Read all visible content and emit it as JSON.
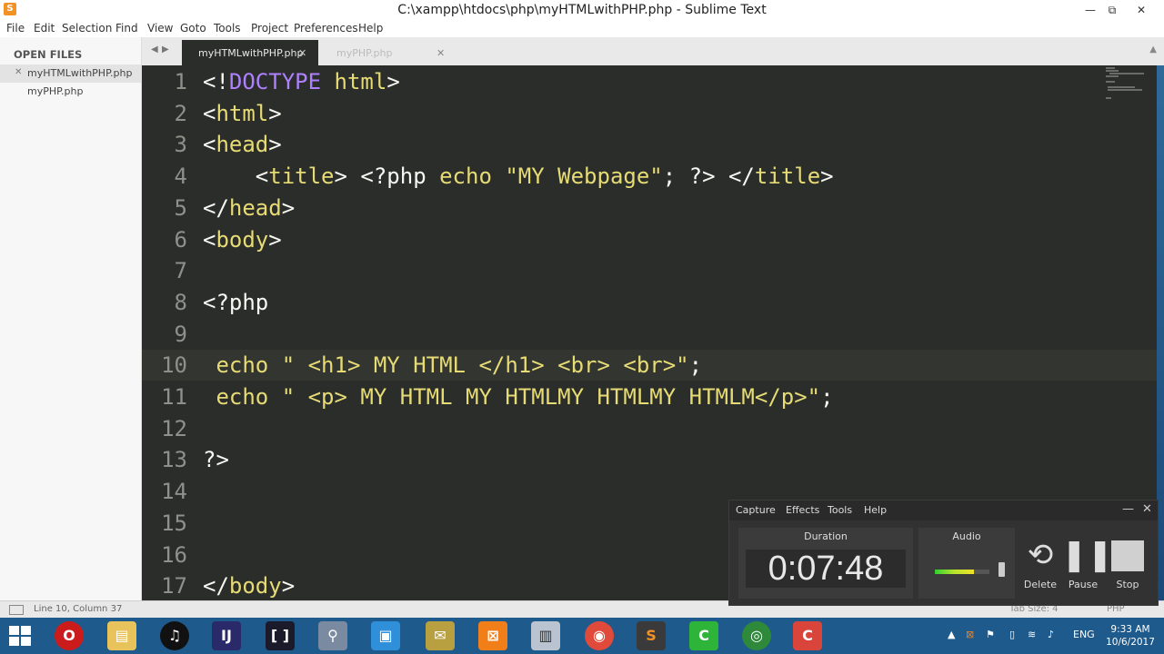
{
  "window": {
    "title": "C:\\xampp\\htdocs\\php\\myHTMLwithPHP.php - Sublime Text",
    "controls": [
      "—",
      "⧉",
      "✕"
    ]
  },
  "menubar": {
    "items": [
      "File",
      "Edit",
      "Selection",
      "Find",
      "View",
      "Goto",
      "Tools",
      "Project",
      "Preferences",
      "Help"
    ]
  },
  "sidebar": {
    "header": "OPEN FILES",
    "files": [
      {
        "name": "myHTMLwithPHP.php",
        "active": true
      },
      {
        "name": "myPHP.php",
        "active": false
      }
    ]
  },
  "tabs": [
    {
      "label": "myHTMLwithPHP.php",
      "active": true
    },
    {
      "label": "myPHP.php",
      "active": false
    }
  ],
  "editor": {
    "current_line": 10,
    "lines": [
      {
        "n": "1",
        "parts": [
          [
            "br",
            "<!"
          ],
          [
            "doc",
            "DOCTYPE"
          ],
          [
            "tag",
            " html"
          ],
          [
            "br",
            ">"
          ]
        ]
      },
      {
        "n": "2",
        "parts": [
          [
            "br",
            "<"
          ],
          [
            "tag",
            "html"
          ],
          [
            "br",
            ">"
          ]
        ]
      },
      {
        "n": "3",
        "parts": [
          [
            "br",
            "<"
          ],
          [
            "tag",
            "head"
          ],
          [
            "br",
            ">"
          ]
        ]
      },
      {
        "n": "4",
        "parts": [
          [
            "br",
            "    <"
          ],
          [
            "tag",
            "title"
          ],
          [
            "br",
            "> <?php "
          ],
          [
            "tag",
            "echo "
          ],
          [
            "tag",
            "\"MY Webpage\""
          ],
          [
            "br",
            "; ?> </"
          ],
          [
            "tag",
            "title"
          ],
          [
            "br",
            ">"
          ]
        ]
      },
      {
        "n": "5",
        "parts": [
          [
            "br",
            "</"
          ],
          [
            "tag",
            "head"
          ],
          [
            "br",
            ">"
          ]
        ]
      },
      {
        "n": "6",
        "parts": [
          [
            "br",
            "<"
          ],
          [
            "tag",
            "body"
          ],
          [
            "br",
            ">"
          ]
        ]
      },
      {
        "n": "7",
        "parts": []
      },
      {
        "n": "8",
        "parts": [
          [
            "br",
            "<?php"
          ]
        ]
      },
      {
        "n": "9",
        "parts": []
      },
      {
        "n": "10",
        "parts": [
          [
            "tag",
            " echo "
          ],
          [
            "tag",
            "\" <h1> MY HTML </h1> <br> <br>\""
          ],
          [
            "br",
            ";"
          ]
        ]
      },
      {
        "n": "11",
        "parts": [
          [
            "tag",
            " echo "
          ],
          [
            "tag",
            "\" <p> MY HTML MY HTMLMY HTMLMY HTMLM</p>\""
          ],
          [
            "br",
            ";"
          ]
        ]
      },
      {
        "n": "12",
        "parts": []
      },
      {
        "n": "13",
        "parts": [
          [
            "br",
            "?>"
          ]
        ]
      },
      {
        "n": "14",
        "parts": []
      },
      {
        "n": "15",
        "parts": []
      },
      {
        "n": "16",
        "parts": []
      },
      {
        "n": "17",
        "parts": [
          [
            "br",
            "</"
          ],
          [
            "tag",
            "body"
          ],
          [
            "br",
            ">"
          ]
        ]
      }
    ]
  },
  "statusbar": {
    "position": "Line 10, Column 37",
    "tab_size": "Tab Size: 4",
    "syntax": "PHP"
  },
  "recorder": {
    "menu": [
      "Capture",
      "Effects",
      "Tools",
      "Help"
    ],
    "duration_label": "Duration",
    "duration": "0:07:48",
    "audio_label": "Audio",
    "audio_level": 0.72,
    "buttons": [
      {
        "label": "Delete",
        "icon": "undo-icon"
      },
      {
        "label": "Pause",
        "icon": "pause-icon"
      },
      {
        "label": "Stop",
        "icon": "stop-icon"
      }
    ]
  },
  "taskbar": {
    "apps": [
      "opera-icon",
      "file-explorer-icon",
      "headphones-icon",
      "intellij-icon",
      "brackets-icon",
      "magnifier-icon",
      "folder-app-icon",
      "archive-icon",
      "xampp-icon",
      "system-monitor-icon",
      "chrome-icon",
      "sublime-icon",
      "camtasia-icon",
      "network-icon",
      "camtasia-recorder-icon"
    ],
    "tray_lang": "ENG",
    "time": "9:33 AM",
    "date": "10/6/2017"
  },
  "colors": {
    "editor_bg": "#2b2d2a",
    "tag": "#e6db74",
    "taskbar": "#1e5a8c"
  }
}
